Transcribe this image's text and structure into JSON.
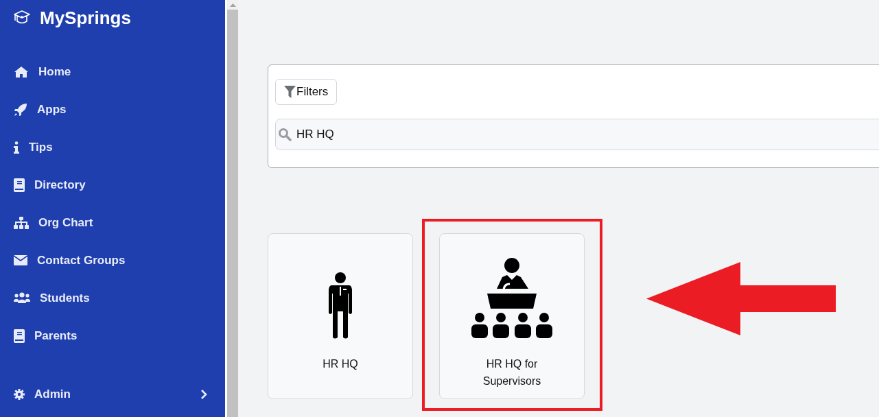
{
  "app": {
    "title": "MySprings"
  },
  "sidebar": {
    "items": [
      {
        "label": "Home"
      },
      {
        "label": "Apps"
      },
      {
        "label": "Tips"
      },
      {
        "label": "Directory"
      },
      {
        "label": "Org Chart"
      },
      {
        "label": "Contact Groups"
      },
      {
        "label": "Students"
      },
      {
        "label": "Parents"
      }
    ],
    "footer_item": {
      "label": "Admin",
      "expanded": false
    }
  },
  "filters": {
    "button": "Filters",
    "search": {
      "value": "HR HQ"
    }
  },
  "cards": [
    {
      "title": "HR HQ",
      "highlighted": false
    },
    {
      "title": "HR HQ for Supervisors",
      "highlighted": true
    }
  ]
}
